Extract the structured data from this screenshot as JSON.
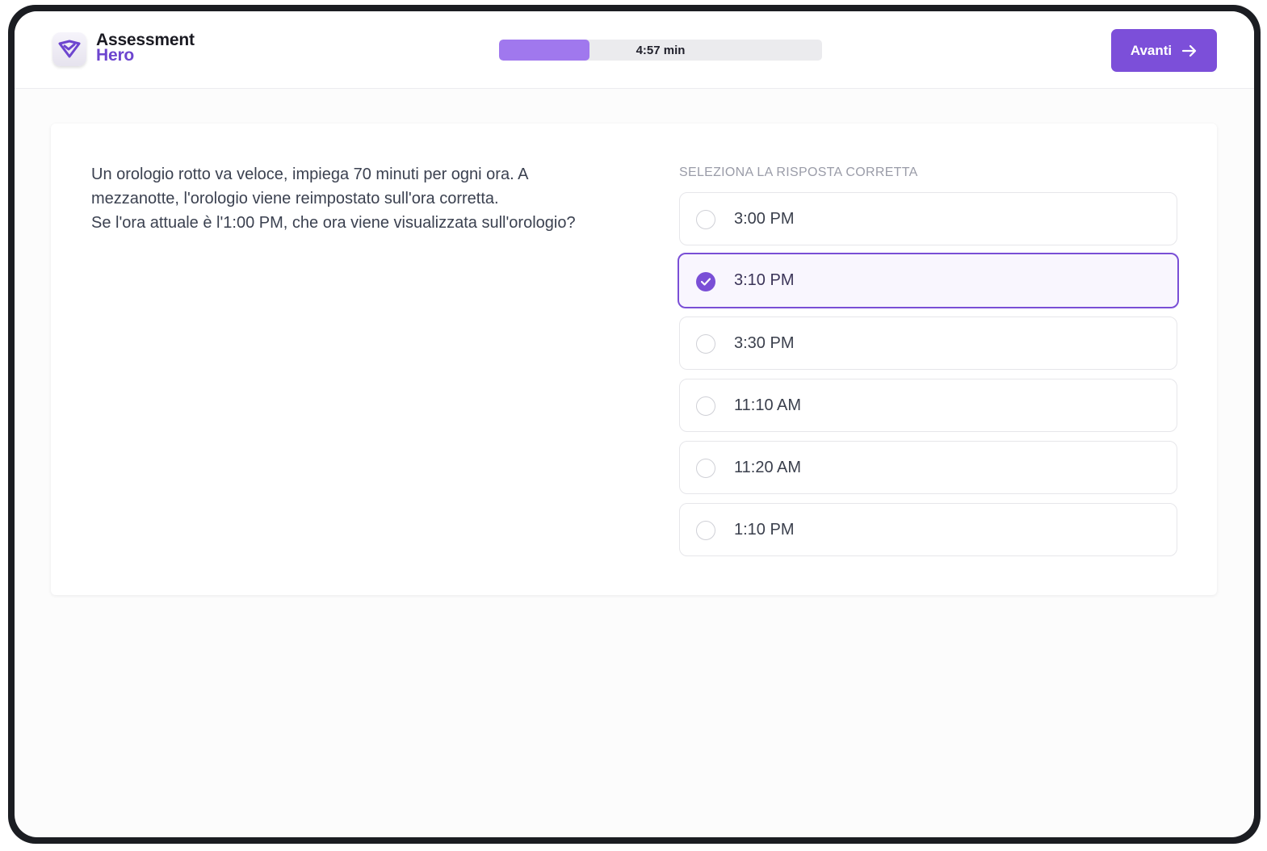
{
  "brand": {
    "name_line1": "Assessment",
    "name_line2": "Hero",
    "accent_color": "#7c4fd9",
    "icon": "shield-check-icon"
  },
  "timer": {
    "label": "4:57 min",
    "progress_fraction": 0.28
  },
  "header": {
    "next_label": "Avanti",
    "next_icon": "arrow-right-icon"
  },
  "question": {
    "text": "Un orologio rotto va veloce, impiega 70 minuti per ogni ora. A mezzanotte, l'orologio viene reimpostato sull'ora corretta.\nSe l'ora attuale è l'1:00 PM, che ora viene visualizzata sull'orologio?"
  },
  "answers": {
    "heading": "SELEZIONA LA RISPOSTA CORRETTA",
    "options": [
      {
        "label": "3:00 PM",
        "selected": false
      },
      {
        "label": "3:10 PM",
        "selected": true
      },
      {
        "label": "3:30 PM",
        "selected": false
      },
      {
        "label": "11:10 AM",
        "selected": false
      },
      {
        "label": "11:20 AM",
        "selected": false
      },
      {
        "label": "1:10 PM",
        "selected": false
      }
    ]
  }
}
